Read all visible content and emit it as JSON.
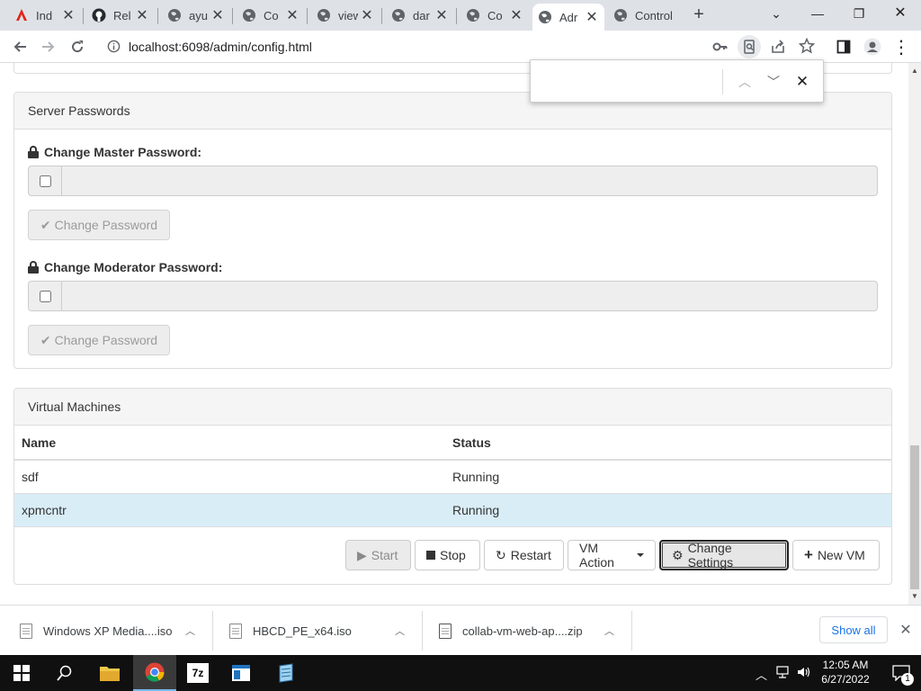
{
  "browser": {
    "tabs": [
      {
        "title": "Ind",
        "icon": "acrobat-icon",
        "active": false
      },
      {
        "title": "Rel",
        "icon": "github-icon",
        "active": false
      },
      {
        "title": "ayu",
        "icon": "globe-icon",
        "active": false
      },
      {
        "title": "Co",
        "icon": "globe-icon",
        "active": false
      },
      {
        "title": "view",
        "icon": "globe-icon",
        "active": false
      },
      {
        "title": "dar",
        "icon": "globe-icon",
        "active": false
      },
      {
        "title": "Co",
        "icon": "globe-icon",
        "active": false
      },
      {
        "title": "Adr",
        "icon": "globe-icon",
        "active": true
      },
      {
        "title": "Control",
        "icon": "globe-icon",
        "active": false
      }
    ],
    "url": "localhost:6098/admin/config.html"
  },
  "server_passwords": {
    "heading": "Server Passwords",
    "master_label": "Change Master Password:",
    "moderator_label": "Change Moderator Password:",
    "change_button": "Change Password"
  },
  "virtual_machines": {
    "heading": "Virtual Machines",
    "columns": [
      "Name",
      "Status"
    ],
    "rows": [
      {
        "name": "sdf",
        "status": "Running",
        "selected": false
      },
      {
        "name": "xpmcntr",
        "status": "Running",
        "selected": true
      }
    ],
    "buttons": {
      "start": "Start",
      "stop": "Stop",
      "restart": "Restart",
      "vm_action": "VM Action",
      "change_settings": "Change Settings",
      "new_vm": "New VM"
    }
  },
  "downloads": {
    "items": [
      "Windows XP Media....iso",
      "HBCD_PE_x64.iso",
      "collab-vm-web-ap....zip"
    ],
    "show_all": "Show all"
  },
  "taskbar": {
    "time": "12:05 AM",
    "date": "6/27/2022",
    "notification_count": "1"
  },
  "colors": {
    "selected_row": "#d9edf7",
    "panel_heading": "#f5f5f5",
    "link_blue": "#1a73e8"
  }
}
